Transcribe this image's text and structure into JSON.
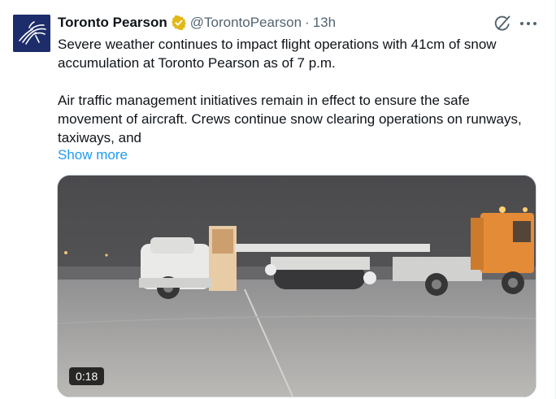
{
  "tweet": {
    "display_name": "Toronto Pearson",
    "handle": "@TorontoPearson",
    "separator": "·",
    "time": "13h",
    "paragraph_1": "Severe weather continues to impact flight operations with 41cm of snow accumulation at Toronto Pearson as of 7 p.m.",
    "paragraph_2": "Air traffic management initiatives remain in effect to ensure the safe movement of aircraft. Crews continue snow clearing operations on runways, taxiways, and",
    "show_more": "Show more"
  },
  "media": {
    "type": "video",
    "duration": "0:18",
    "content_description": "snow-clearing-vehicles-on-airport-apron-at-night"
  },
  "icons": {
    "verified": "verified-badge-icon",
    "grok": "grok-icon",
    "more": "more-options-icon"
  },
  "colors": {
    "text_primary": "#0f1419",
    "text_secondary": "#536471",
    "link": "#1d9bf0",
    "verified_gold": "#e2b719",
    "avatar_bg": "#1d2d6b"
  }
}
